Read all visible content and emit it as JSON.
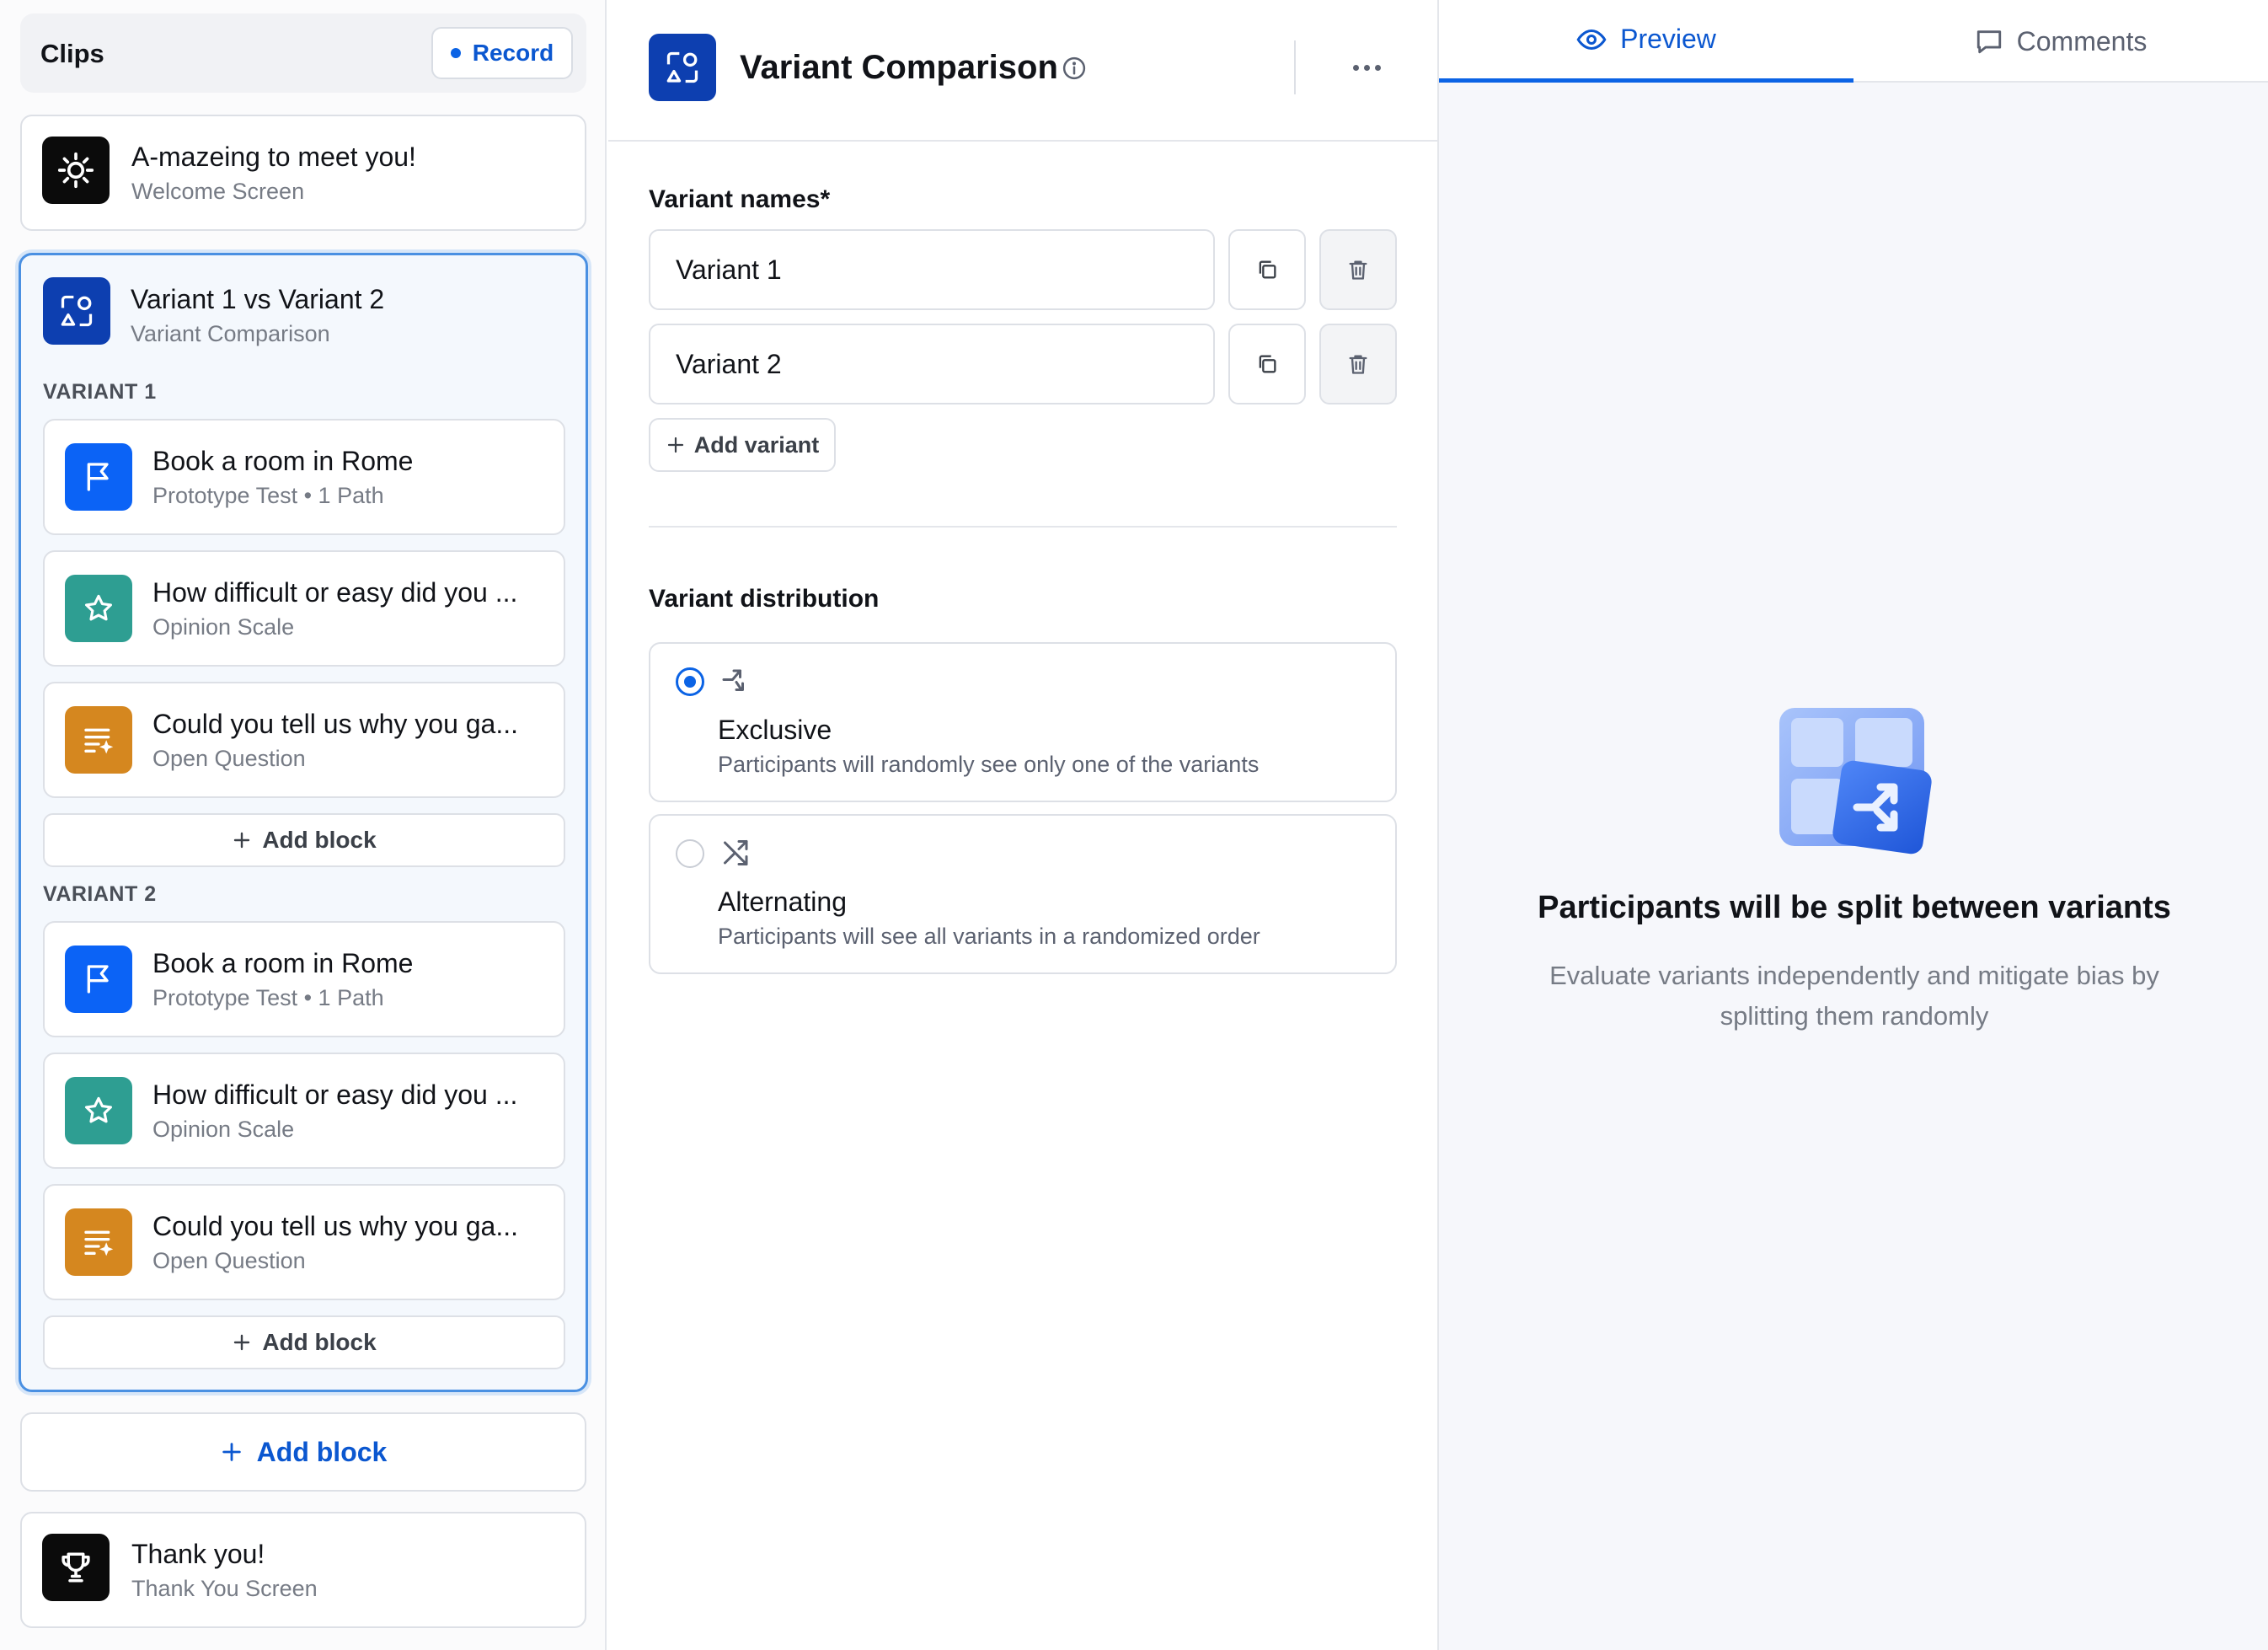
{
  "sidebar": {
    "title": "Clips",
    "record_label": "Record",
    "welcome": {
      "title": "A-mazeing to meet you!",
      "subtitle": "Welcome Screen",
      "icon": "sun-icon"
    },
    "group": {
      "title": "Variant 1 vs Variant 2",
      "subtitle": "Variant Comparison",
      "icon": "shapes-icon",
      "variants": [
        {
          "label": "VARIANT 1",
          "blocks": [
            {
              "title": "Book a room in Rome",
              "subtitle": "Prototype Test • 1 Path",
              "icon": "flag-icon",
              "color": "#0b63f6"
            },
            {
              "title": "How difficult or easy did you ...",
              "subtitle": "Opinion Scale",
              "icon": "star-icon",
              "color": "#2e9e92"
            },
            {
              "title": "Could you tell us why you ga...",
              "subtitle": "Open Question",
              "icon": "text-sparkle-icon",
              "color": "#d5871f"
            }
          ],
          "add_block_label": "Add block"
        },
        {
          "label": "VARIANT 2",
          "blocks": [
            {
              "title": "Book a room in Rome",
              "subtitle": "Prototype Test • 1 Path",
              "icon": "flag-icon",
              "color": "#0b63f6"
            },
            {
              "title": "How difficult or easy did you ...",
              "subtitle": "Opinion Scale",
              "icon": "star-icon",
              "color": "#2e9e92"
            },
            {
              "title": "Could you tell us why you ga...",
              "subtitle": "Open Question",
              "icon": "text-sparkle-icon",
              "color": "#d5871f"
            }
          ],
          "add_block_label": "Add block"
        }
      ]
    },
    "add_block_label": "Add block",
    "thanks": {
      "title": "Thank you!",
      "subtitle": "Thank You Screen",
      "icon": "trophy-icon"
    }
  },
  "editor": {
    "title": "Variant Comparison",
    "variant_names_label": "Variant names*",
    "variant_names": [
      "Variant 1",
      "Variant 2"
    ],
    "add_variant_label": "Add variant",
    "distribution_label": "Variant distribution",
    "distribution_options": [
      {
        "title": "Exclusive",
        "description": "Participants will randomly see only one of the variants",
        "selected": true,
        "icon": "split-arrow-icon"
      },
      {
        "title": "Alternating",
        "description": "Participants will see all variants in a randomized order",
        "selected": false,
        "icon": "shuffle-icon"
      }
    ]
  },
  "preview": {
    "tabs": [
      {
        "label": "Preview",
        "icon": "eye-icon",
        "active": true
      },
      {
        "label": "Comments",
        "icon": "comment-icon",
        "active": false
      }
    ],
    "empty_title": "Participants will be split between variants",
    "empty_description": "Evaluate variants independently and mitigate bias by splitting them randomly"
  },
  "colors": {
    "accent": "#0b63e5",
    "brand_dark": "#0d3fb0",
    "prototype": "#0b63f6",
    "opinion": "#2e9e92",
    "question": "#d5871f"
  }
}
